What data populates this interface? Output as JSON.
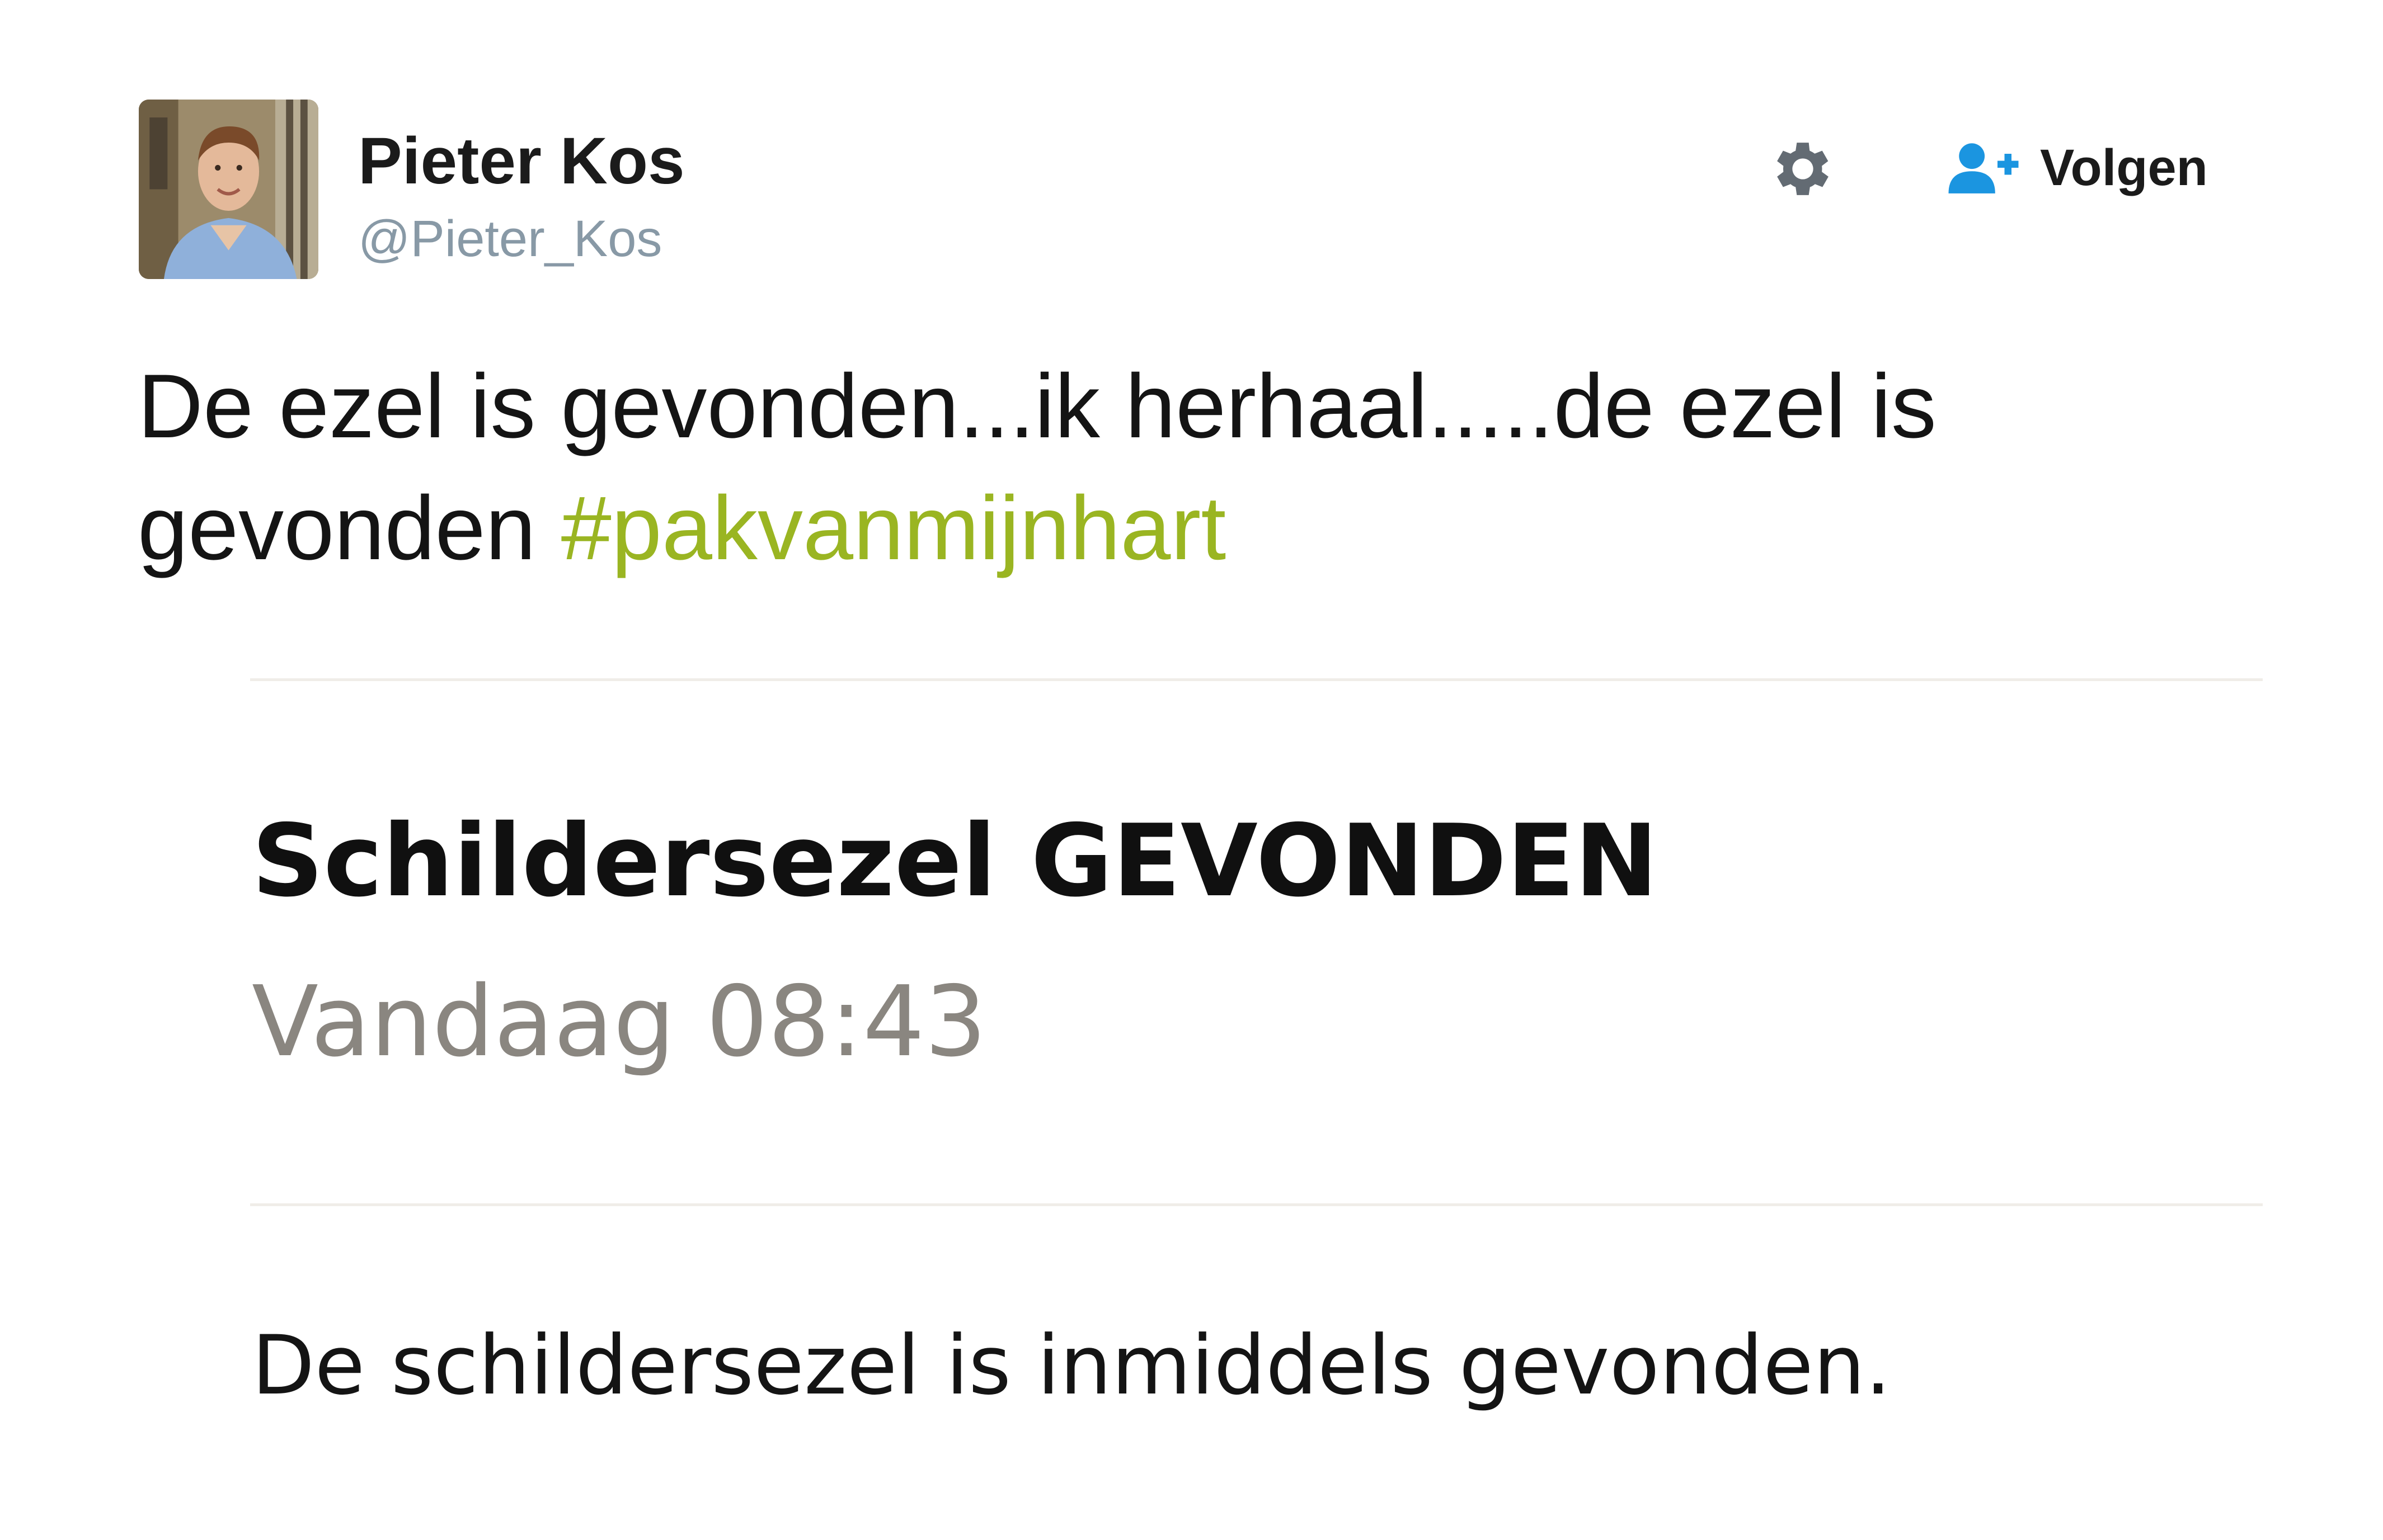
{
  "author": {
    "name": "Pieter Kos",
    "handle": "@Pieter_Kos",
    "avatar_icon": "profile-photo"
  },
  "actions": {
    "settings_icon": "gear-icon",
    "follow_icon": "add-user-icon",
    "follow_label": "Volgen",
    "accent_color": "#1b95e0"
  },
  "tweet": {
    "text": "De ezel is gevonden...ik herhaal.....de ezel is gevonden",
    "hashtag": "#pakvanmijnhart",
    "hashtag_color": "#9ab522"
  },
  "notice": {
    "title": "Schildersezel GEVONDEN",
    "time": "Vandaag 08:43",
    "body": "De schildersezel is inmiddels gevonden."
  }
}
